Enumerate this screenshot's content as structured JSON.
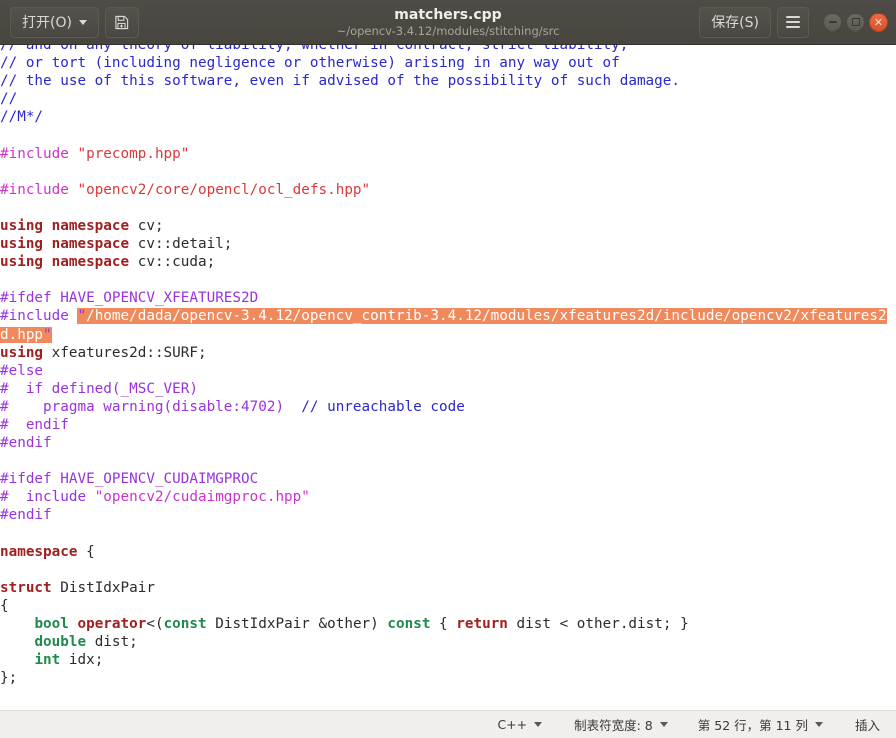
{
  "titlebar": {
    "open_button": "打开(O)",
    "open_icon": "chevron-down-icon",
    "save_icon_button": "save-disk-icon",
    "title": "matchers.cpp",
    "subtitle": "~/opencv-3.4.12/modules/stitching/src",
    "save_button": "保存(S)",
    "menu_icon": "hamburger-menu-icon",
    "minimize": "minimize-icon",
    "maximize": "maximize-icon",
    "close": "✕",
    "bg_color": "#4b4842",
    "close_color": "#e35b2c"
  },
  "editor": {
    "lines": [
      {
        "tokens": [
          {
            "t": "// and on any theory of liability, whether in contract, strict liability,",
            "c": "c-comment"
          }
        ]
      },
      {
        "tokens": [
          {
            "t": "// or tort (including negligence or otherwise) arising in any way out of",
            "c": "c-comment"
          }
        ]
      },
      {
        "tokens": [
          {
            "t": "// the use of this software, even if advised of the possibility of such damage.",
            "c": "c-comment"
          }
        ]
      },
      {
        "tokens": [
          {
            "t": "//",
            "c": "c-comment"
          }
        ]
      },
      {
        "tokens": [
          {
            "t": "//M*/",
            "c": "c-comment"
          }
        ]
      },
      {
        "tokens": []
      },
      {
        "tokens": [
          {
            "t": "#include",
            "c": "c-pre"
          },
          {
            "t": " ",
            "c": "c-plain"
          },
          {
            "t": "\"precomp.hpp\"",
            "c": "c-string"
          }
        ]
      },
      {
        "tokens": []
      },
      {
        "tokens": [
          {
            "t": "#include",
            "c": "c-pre"
          },
          {
            "t": " ",
            "c": "c-plain"
          },
          {
            "t": "\"opencv2/core/opencl/ocl_defs.hpp\"",
            "c": "c-string"
          }
        ]
      },
      {
        "tokens": []
      },
      {
        "tokens": [
          {
            "t": "using namespace",
            "c": "c-keyword"
          },
          {
            "t": " cv;",
            "c": "c-plain"
          }
        ]
      },
      {
        "tokens": [
          {
            "t": "using namespace",
            "c": "c-keyword"
          },
          {
            "t": " cv::detail;",
            "c": "c-plain"
          }
        ]
      },
      {
        "tokens": [
          {
            "t": "using namespace",
            "c": "c-keyword"
          },
          {
            "t": " cv::cuda;",
            "c": "c-plain"
          }
        ]
      },
      {
        "tokens": []
      },
      {
        "tokens": [
          {
            "t": "#ifdef",
            "c": "c-preword"
          },
          {
            "t": " HAVE_OPENCV_XFEATURES2D",
            "c": "c-preword"
          }
        ]
      },
      {
        "tokens": [
          {
            "t": "#include",
            "c": "c-preword"
          },
          {
            "t": " ",
            "c": "c-plain"
          },
          {
            "t": "\"",
            "c": "c-sel-q"
          },
          {
            "t": "/home/dada/opencv-3.4.12/opencv_contrib-3.4.12/modules/xfeatures2d/include/opencv2/xfeatures2d.hpp",
            "c": "c-sel"
          },
          {
            "t": "\"",
            "c": "c-sel-q"
          }
        ]
      },
      {
        "tokens": [
          {
            "t": "using",
            "c": "c-keyword"
          },
          {
            "t": " xfeatures2d::SURF;",
            "c": "c-plain"
          }
        ]
      },
      {
        "tokens": [
          {
            "t": "#else",
            "c": "c-preword"
          }
        ]
      },
      {
        "tokens": [
          {
            "t": "#  if defined(_MSC_VER)",
            "c": "c-preword"
          }
        ]
      },
      {
        "tokens": [
          {
            "t": "#    pragma warning(disable:4702)",
            "c": "c-preword"
          },
          {
            "t": "  ",
            "c": "c-plain"
          },
          {
            "t": "// unreachable code",
            "c": "c-comment"
          }
        ]
      },
      {
        "tokens": [
          {
            "t": "#  endif",
            "c": "c-preword"
          }
        ]
      },
      {
        "tokens": [
          {
            "t": "#endif",
            "c": "c-preword"
          }
        ]
      },
      {
        "tokens": []
      },
      {
        "tokens": [
          {
            "t": "#ifdef",
            "c": "c-preword"
          },
          {
            "t": " HAVE_OPENCV_CUDAIMGPROC",
            "c": "c-preword"
          }
        ]
      },
      {
        "tokens": [
          {
            "t": "#  include",
            "c": "c-preword"
          },
          {
            "t": " ",
            "c": "c-plain"
          },
          {
            "t": "\"opencv2/cudaimgproc.hpp\"",
            "c": "c-pre"
          }
        ]
      },
      {
        "tokens": [
          {
            "t": "#endif",
            "c": "c-preword"
          }
        ]
      },
      {
        "tokens": []
      },
      {
        "tokens": [
          {
            "t": "namespace",
            "c": "c-keyword"
          },
          {
            "t": " {",
            "c": "c-plain"
          }
        ]
      },
      {
        "tokens": []
      },
      {
        "tokens": [
          {
            "t": "struct",
            "c": "c-keyword"
          },
          {
            "t": " DistIdxPair",
            "c": "c-plain"
          }
        ]
      },
      {
        "tokens": [
          {
            "t": "{",
            "c": "c-plain"
          }
        ]
      },
      {
        "tokens": [
          {
            "t": "    ",
            "c": "c-plain"
          },
          {
            "t": "bool",
            "c": "c-type"
          },
          {
            "t": " ",
            "c": "c-plain"
          },
          {
            "t": "operator",
            "c": "c-keyword"
          },
          {
            "t": "<(",
            "c": "c-plain"
          },
          {
            "t": "const",
            "c": "c-type"
          },
          {
            "t": " DistIdxPair &other) ",
            "c": "c-plain"
          },
          {
            "t": "const",
            "c": "c-type"
          },
          {
            "t": " { ",
            "c": "c-plain"
          },
          {
            "t": "return",
            "c": "c-keyword"
          },
          {
            "t": " dist < other.dist; }",
            "c": "c-plain"
          }
        ]
      },
      {
        "tokens": [
          {
            "t": "    ",
            "c": "c-plain"
          },
          {
            "t": "double",
            "c": "c-type"
          },
          {
            "t": " dist;",
            "c": "c-plain"
          }
        ]
      },
      {
        "tokens": [
          {
            "t": "    ",
            "c": "c-plain"
          },
          {
            "t": "int",
            "c": "c-type"
          },
          {
            "t": " idx;",
            "c": "c-plain"
          }
        ]
      },
      {
        "tokens": [
          {
            "t": "};",
            "c": "c-plain"
          }
        ]
      }
    ]
  },
  "statusbar": {
    "language": "C++",
    "tab_width": "制表符宽度: 8",
    "position": "第 52 行，第 11 列",
    "insert_mode": "插入"
  }
}
